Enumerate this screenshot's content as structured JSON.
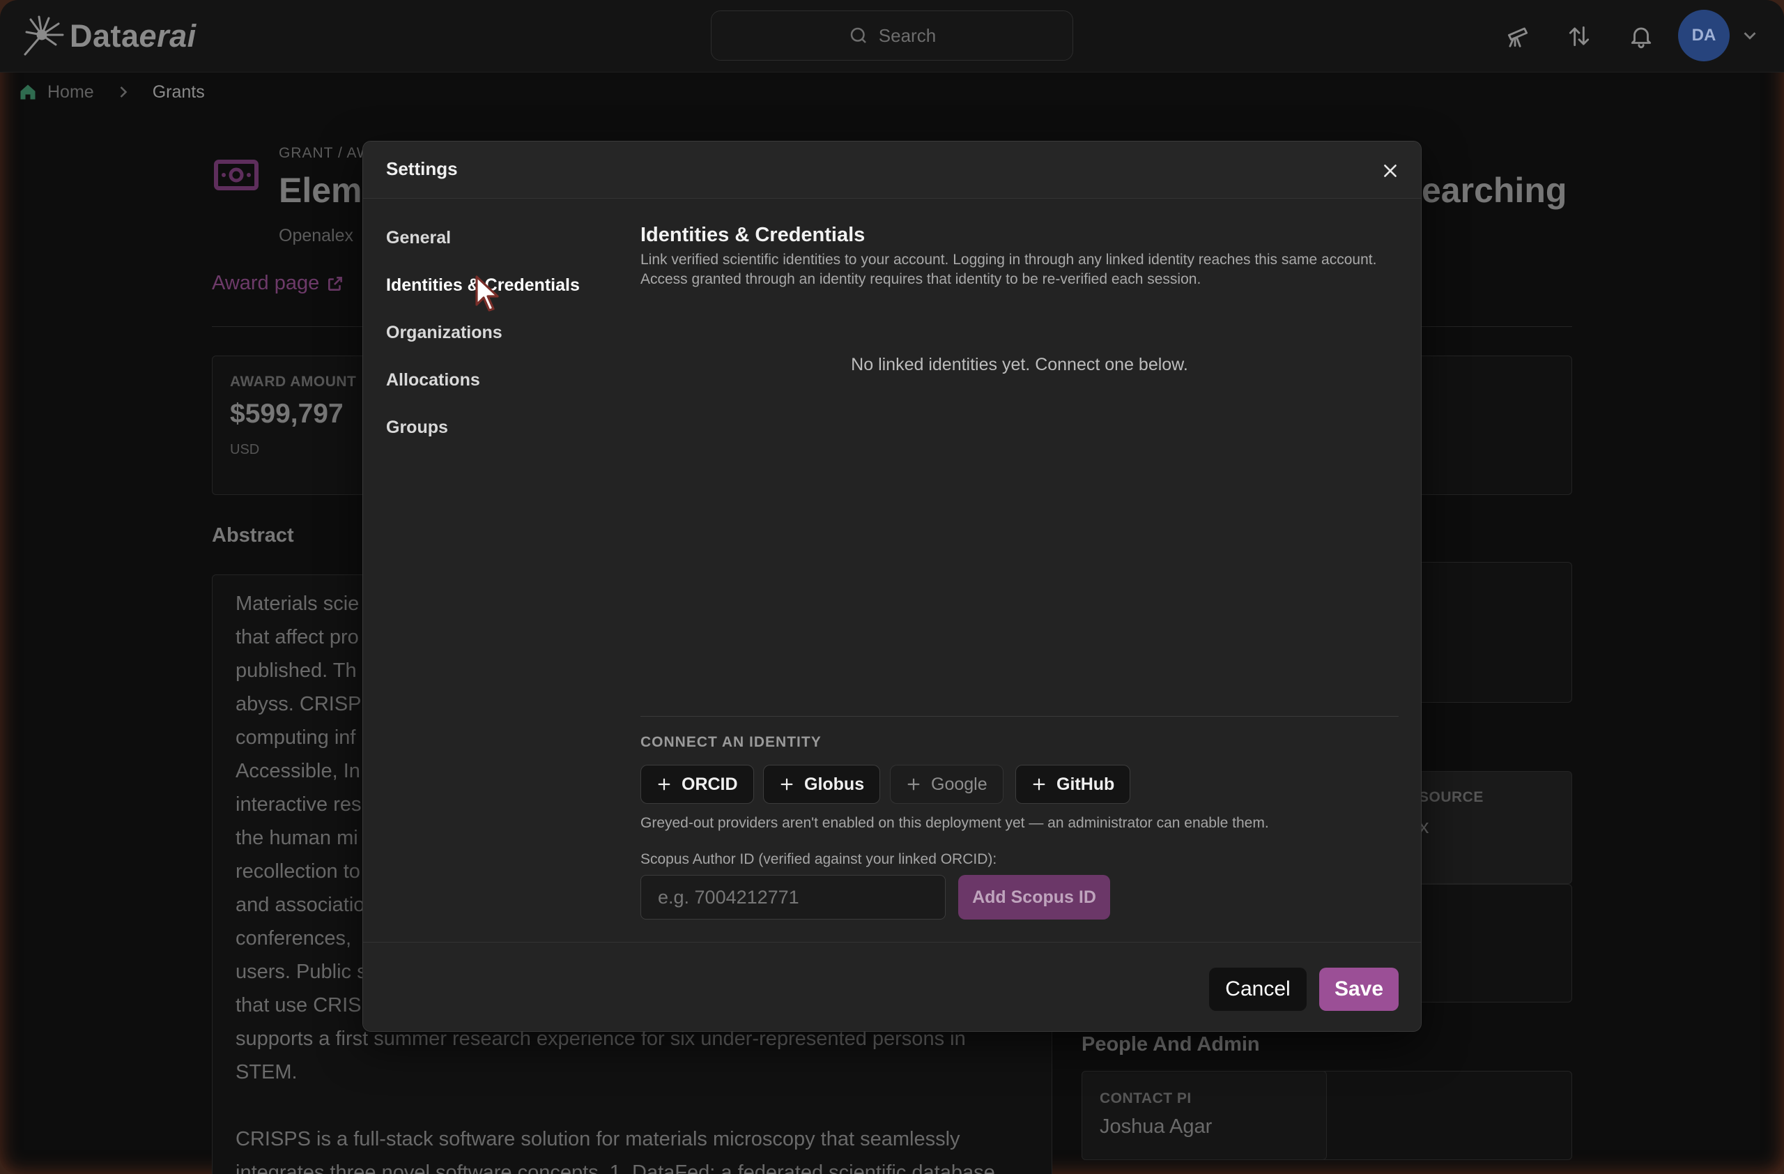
{
  "topbar": {
    "logo": {
      "prefix": "Data",
      "suffix": "erai"
    },
    "search_label": "Search",
    "avatar_initials": "DA"
  },
  "breadcrumb": {
    "home": "Home",
    "current": "Grants"
  },
  "background": {
    "kicker": "GRANT / AW",
    "title_start": "Elem",
    "title_end": "earching",
    "source": "Openalex",
    "award_link": "Award page",
    "award_amount_label": "AWARD AMOUNT",
    "award_amount_value": "$599,797",
    "award_amount_unit": "USD",
    "abstract_heading": "Abstract",
    "abstract_lines": [
      "Materials scie",
      "that affect pro",
      "published. Th",
      "abyss. CRISPS",
      "computing inf",
      "Accessible, In",
      "interactive res",
      "the human mi",
      "recollection to",
      "and associatio",
      "conferences,",
      "users. Public s",
      "that use CRISI",
      "supports a first summer research experience for six under-represented persons in",
      "STEM."
    ],
    "abstract_p2": [
      "CRISPS is a full-stack software solution for materials microscopy that seamlessly",
      "integrates three novel software concepts. 1. DataFed: a federated scientific database"
    ],
    "source_label": "SOURCE",
    "source_value": "x",
    "people_heading": "People And Admin",
    "contact_label": "CONTACT PI",
    "contact_value": "Joshua Agar"
  },
  "modal": {
    "title": "Settings",
    "sidebar": [
      {
        "label": "General"
      },
      {
        "label": "Identities & Credentials"
      },
      {
        "label": "Organizations"
      },
      {
        "label": "Allocations"
      },
      {
        "label": "Groups"
      }
    ],
    "content": {
      "title": "Identities & Credentials",
      "description_line1": "Link verified scientific identities to your account. Logging in through any linked identity reaches this same account.",
      "description_line2": "Access granted through an identity requires that identity to be re-verified each session.",
      "empty_message": "No linked identities yet. Connect one below.",
      "connect_label": "CONNECT AN IDENTITY",
      "providers": [
        {
          "label": "ORCID",
          "enabled": true
        },
        {
          "label": "Globus",
          "enabled": true
        },
        {
          "label": "Google",
          "enabled": false
        },
        {
          "label": "GitHub",
          "enabled": true
        }
      ],
      "greyed_note": "Greyed-out providers aren't enabled on this deployment yet — an administrator can enable them.",
      "scopus_label": "Scopus Author ID (verified against your linked ORCID):",
      "scopus_placeholder": "e.g. 7004212771",
      "scopus_value": "",
      "scopus_button": "Add Scopus ID"
    },
    "footer": {
      "cancel": "Cancel",
      "save": "Save"
    }
  },
  "colors": {
    "accent": "#9b4f96",
    "accent_muted": "#6b3768",
    "modal_bg": "#232323",
    "page_bg": "#0d0d0d"
  }
}
